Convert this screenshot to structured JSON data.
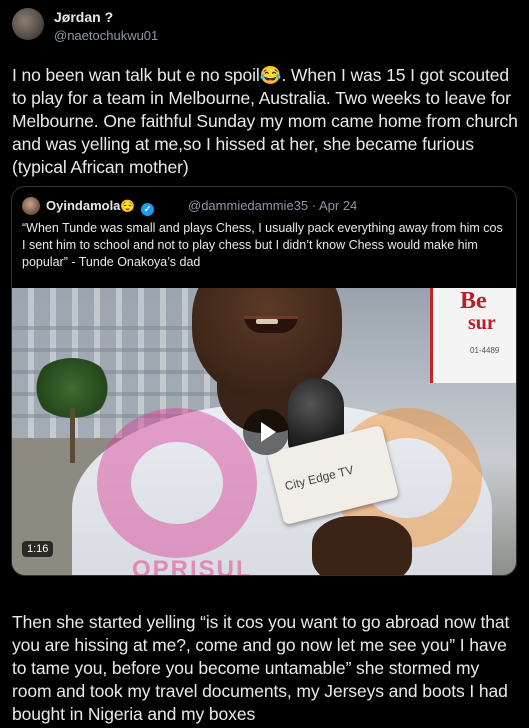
{
  "tweet": {
    "display_name": "Jørdan ?",
    "handle": "@naetochukwu01",
    "text": "I no been wan talk but e no spoil😂. When I was 15 I got scouted to play for a team in Melbourne, Australia. Two weeks to leave for Melbourne. One faithful Sunday my mom came home from church and was yelling at me,so I hissed at her, she became furious (typical African mother)",
    "continuation": "Then she started yelling “is it cos you want to go abroad now that you are hissing at me?, come and go now let me see you” I have to tame you, before you become untamable” she stormed my room and took my travel documents, my Jerseys and boots I had bought in Nigeria and my boxes"
  },
  "quoted": {
    "display_name": "Oyindamola",
    "name_emoji": "😌",
    "handle": "@dammiedammie35",
    "date": "· Apr 24",
    "text": "“When Tunde was small and plays Chess, I usually pack everything away from him cos I sent him to school and not to play chess but I didn’t know Chess would make him popular” - Tunde Onakoya’s dad",
    "video": {
      "duration": "1:16",
      "mic_flag_text": "City Edge TV",
      "sign_line1": "Be",
      "sign_line2": "sur",
      "sign_line3": "01-4489",
      "watermark_text": "OPRISUL"
    }
  },
  "icons": {
    "verified": "verified-badge-icon",
    "play": "play-icon"
  },
  "colors": {
    "background": "#000000",
    "text": "#e7e9ea",
    "secondary_text": "#8b98a5",
    "verified": "#1d9bf0",
    "border": "#2f3336"
  }
}
